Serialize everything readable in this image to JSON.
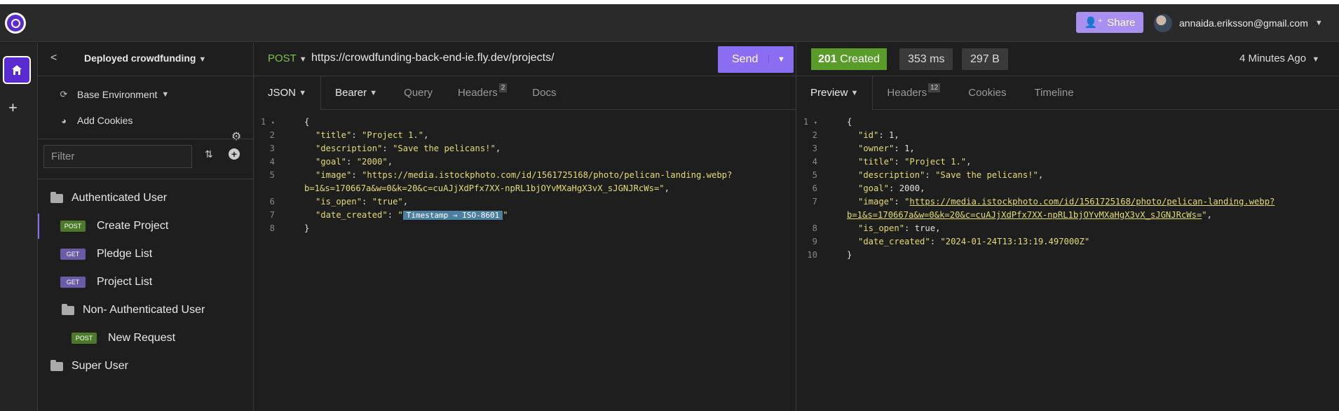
{
  "topbar": {
    "share_label": "Share",
    "user_email": "annaida.eriksson@gmail.com"
  },
  "sidebar": {
    "title": "Deployed crowdfunding",
    "environment": "Base Environment",
    "add_cookies": "Add Cookies",
    "filter_placeholder": "Filter",
    "tree": [
      {
        "type": "folder",
        "label": "Authenticated User"
      },
      {
        "type": "request",
        "method": "POST",
        "label": "Create Project"
      },
      {
        "type": "request",
        "method": "GET",
        "label": "Pledge List"
      },
      {
        "type": "request",
        "method": "GET",
        "label": "Project List"
      },
      {
        "type": "folder",
        "label": "Non- Authenticated User"
      },
      {
        "type": "request",
        "method": "POST",
        "label": "New Request"
      },
      {
        "type": "folder",
        "label": "Super User"
      }
    ]
  },
  "request": {
    "method": "POST",
    "url": "https://crowdfunding-back-end-ie.fly.dev/projects/",
    "send_label": "Send",
    "tabs": {
      "body": "JSON",
      "auth": "Bearer",
      "query": "Query",
      "headers": "Headers",
      "headers_count": "2",
      "docs": "Docs"
    },
    "body_lines": {
      "l1": "{",
      "title_key": "\"title\"",
      "title_val": "\"Project 1.\"",
      "desc_key": "\"description\"",
      "desc_val": "\"Save the pelicans!\"",
      "goal_key": "\"goal\"",
      "goal_val": "\"2000\"",
      "image_key": "\"image\"",
      "image_val_1": "\"https://media.istockphoto.com/id/1561725168/photo/pelican-landing.webp?",
      "image_val_2": "b=1&s=170667a&w=0&k=20&c=cuAJjXdPfx7XX-npRL1bjOYvMXaHgX3vX_sJGNJRcWs=\"",
      "open_key": "\"is_open\"",
      "open_val": "\"true\"",
      "date_key": "\"date_created\"",
      "date_tag": "Timestamp ⇒ ISO-8601",
      "l8": "}"
    }
  },
  "response": {
    "status_code": "201",
    "status_text": "Created",
    "time": "353 ms",
    "size": "297 B",
    "ago": "4 Minutes Ago",
    "tabs": {
      "preview": "Preview",
      "headers": "Headers",
      "headers_count": "12",
      "cookies": "Cookies",
      "timeline": "Timeline"
    },
    "lines": {
      "id": "1",
      "owner": "1",
      "title": "\"Project 1.\"",
      "description": "\"Save the pelicans!\"",
      "goal": "2000",
      "image_1": "https://media.istockphoto.com/id/1561725168/photo/pelican-landing.webp?",
      "image_2": "b=1&s=170667a&w=0&k=20&c=cuAJjXdPfx7XX-npRL1bjOYvMXaHgX3vX_sJGNJRcWs=",
      "is_open": "true",
      "date_created": "\"2024-01-24T13:13:19.497000Z\""
    }
  }
}
